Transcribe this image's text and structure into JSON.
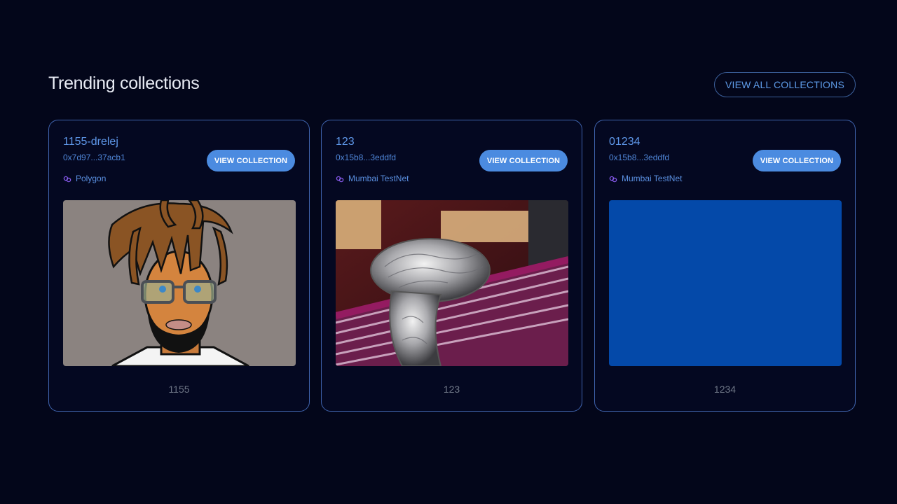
{
  "section": {
    "title": "Trending collections",
    "view_all_label": "VIEW ALL COLLECTIONS"
  },
  "cards": [
    {
      "name": "1155-drelej",
      "address": "0x7d97...37acb1",
      "chain": "Polygon",
      "button_label": "VIEW COLLECTION",
      "count": "1155",
      "image": "cartoon-avatar-dreadlocks-glasses"
    },
    {
      "name": "123",
      "address": "0x15b8...3eddfd",
      "chain": "Mumbai TestNet",
      "button_label": "VIEW COLLECTION",
      "count": "123",
      "image": "engraved-chrome-car-mirror"
    },
    {
      "name": "01234",
      "address": "0x15b8...3eddfd",
      "chain": "Mumbai TestNet",
      "button_label": "VIEW COLLECTION",
      "count": "1234",
      "image": "solid-blue-placeholder"
    }
  ],
  "colors": {
    "background": "#03061a",
    "accent": "#4b8be0",
    "card_border": "#3f63ad",
    "chain_icon": "#8a5cf0"
  }
}
